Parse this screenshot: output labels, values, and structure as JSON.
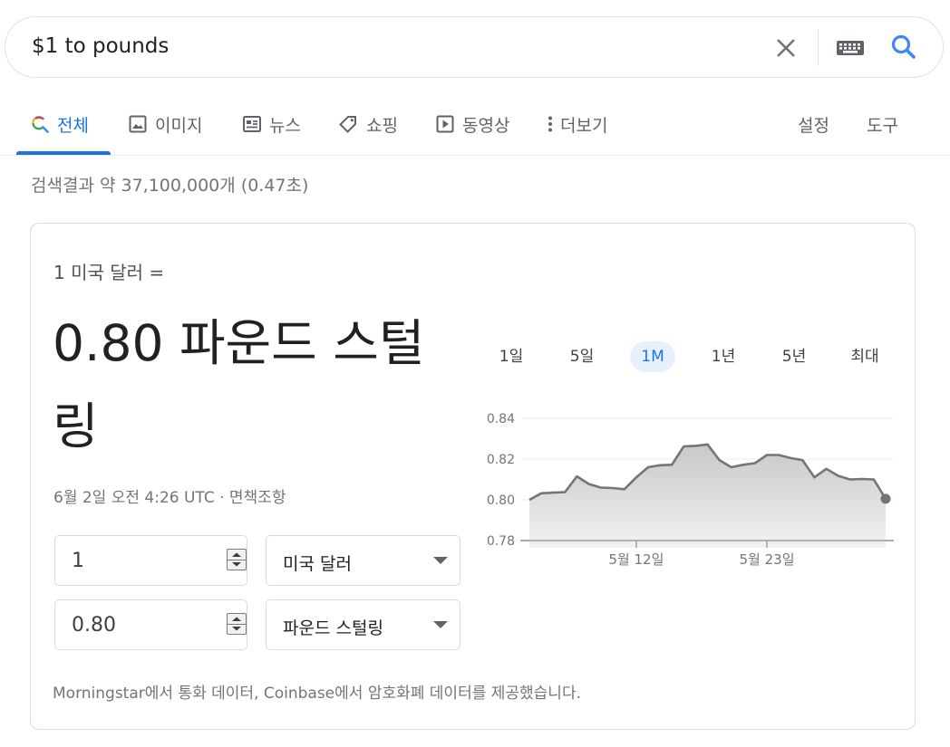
{
  "search": {
    "query": "$1 to pounds",
    "clear_icon": "close-icon",
    "keyboard_icon": "keyboard-icon",
    "search_icon": "search-icon"
  },
  "tabs": [
    {
      "label": "전체",
      "icon": "google-search-icon",
      "active": true
    },
    {
      "label": "이미지",
      "icon": "image-icon"
    },
    {
      "label": "뉴스",
      "icon": "news-icon"
    },
    {
      "label": "쇼핑",
      "icon": "tag-icon"
    },
    {
      "label": "동영상",
      "icon": "play-icon"
    },
    {
      "label": "더보기",
      "icon": "more-vert-icon"
    }
  ],
  "tools": {
    "settings": "설정",
    "tools": "도구"
  },
  "result_stats": "검색결과 약 37,100,000개 (0.47초)",
  "converter": {
    "from_line": "1 미국 달러 =",
    "result": "0.80 파운드 스털링",
    "timestamp": "6월 2일 오전 4:26 UTC",
    "separator": "·",
    "disclaimer": "면책조항",
    "from_amount": "1",
    "from_currency": "미국 달러",
    "to_amount": "0.80",
    "to_currency": "파운드 스털링",
    "footer": "Morningstar에서 통화 데이터, Coinbase에서 암호화폐 데이터를 제공했습니다."
  },
  "ranges": [
    "1일",
    "5일",
    "1M",
    "1년",
    "5년",
    "최대"
  ],
  "active_range": "1M",
  "colors": {
    "accent": "#1a73e8",
    "line": "#757575"
  },
  "chart_data": {
    "type": "area",
    "y_ticks": [
      "0.84",
      "0.82",
      "0.80",
      "0.78"
    ],
    "y_tick_values": [
      0.84,
      0.82,
      0.8,
      0.78
    ],
    "ylim": [
      0.78,
      0.84
    ],
    "x_ticks": [
      {
        "label": "5월 12일",
        "index": 9
      },
      {
        "label": "5월 23일",
        "index": 20
      }
    ],
    "values": [
      0.8,
      0.8032,
      0.8035,
      0.8038,
      0.8115,
      0.8078,
      0.806,
      0.8058,
      0.8052,
      0.811,
      0.816,
      0.817,
      0.8172,
      0.8262,
      0.8265,
      0.8272,
      0.8195,
      0.816,
      0.8172,
      0.818,
      0.822,
      0.822,
      0.8205,
      0.8195,
      0.811,
      0.8152,
      0.8118,
      0.81,
      0.8102,
      0.81,
      0.8005
    ],
    "grid": true
  }
}
